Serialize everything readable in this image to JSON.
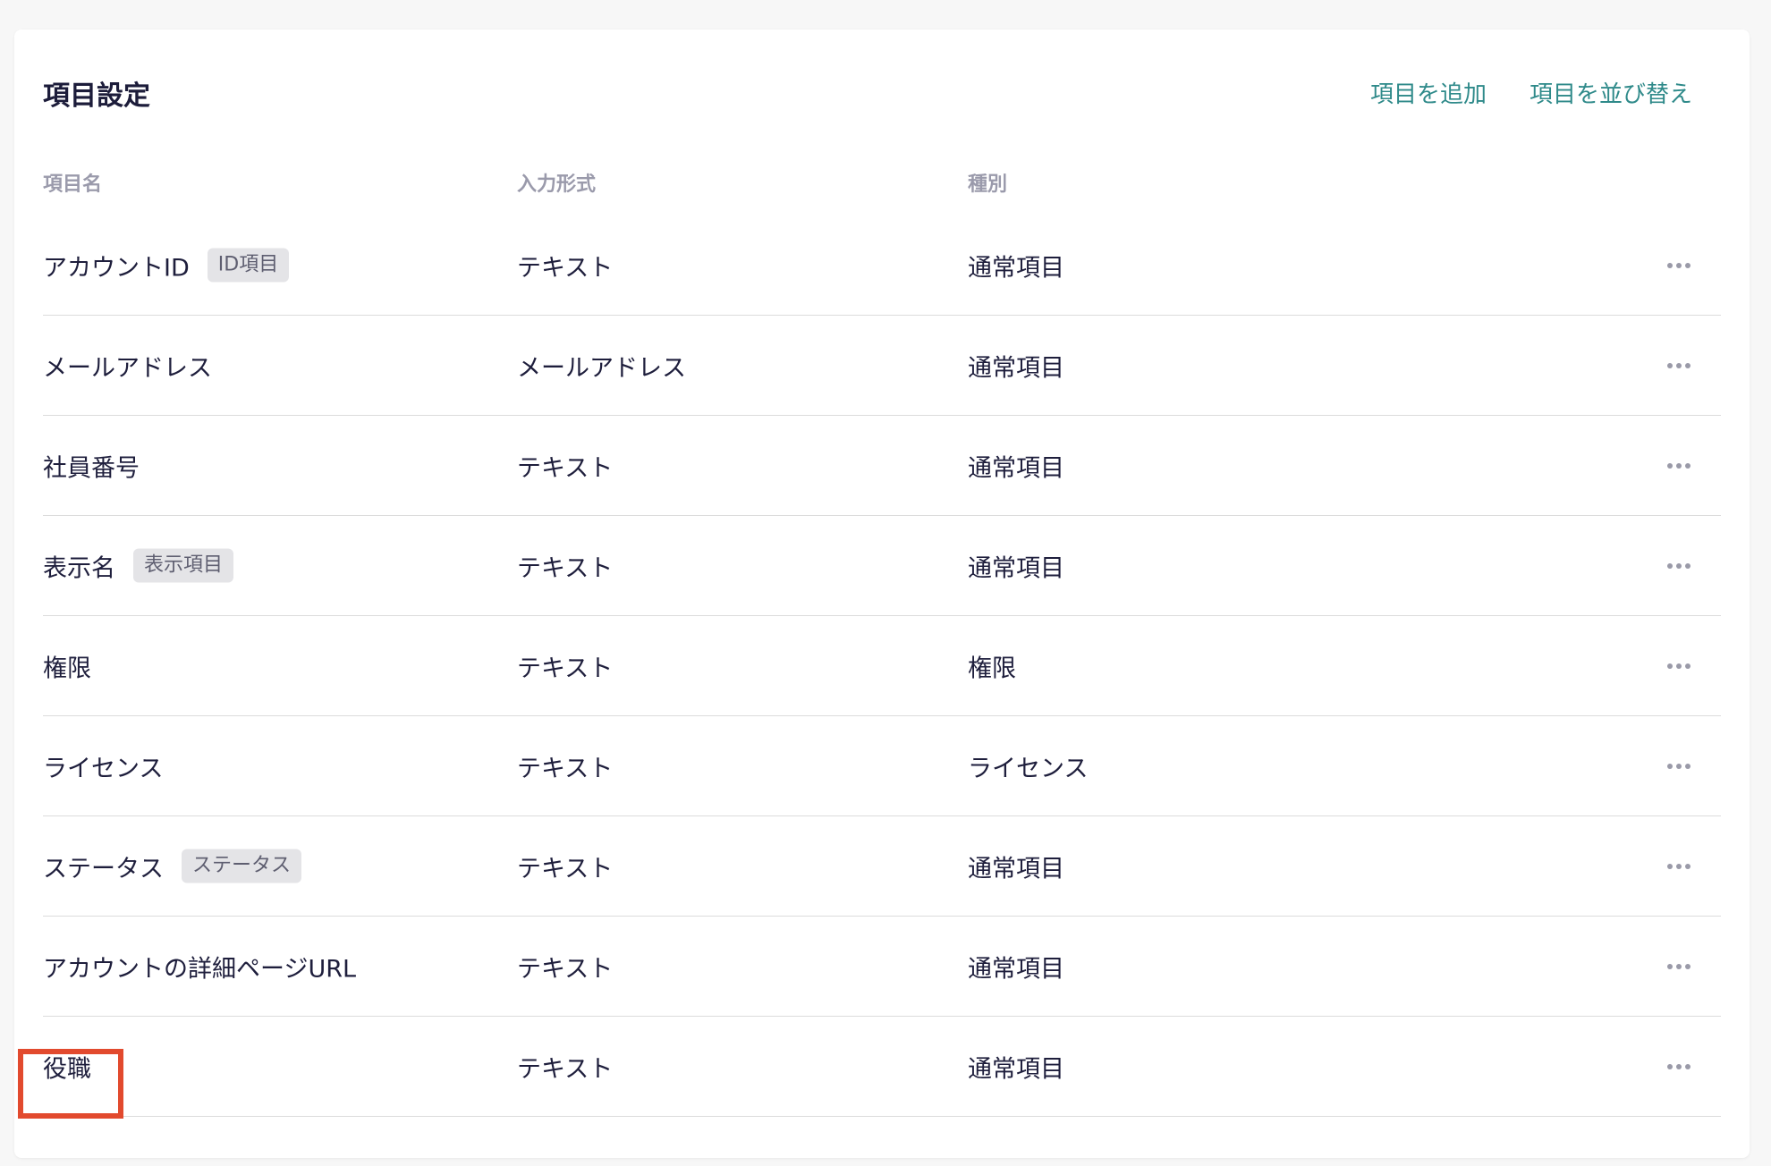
{
  "card": {
    "title": "項目設定",
    "actions": {
      "add_label": "項目を追加",
      "sort_label": "項目を並び替え"
    }
  },
  "table": {
    "headers": {
      "name": "項目名",
      "input_type": "入力形式",
      "kind": "種別"
    },
    "rows": [
      {
        "name": "アカウントID",
        "tag": "ID項目",
        "input_type": "テキスト",
        "kind": "通常項目"
      },
      {
        "name": "メールアドレス",
        "tag": "",
        "input_type": "メールアドレス",
        "kind": "通常項目"
      },
      {
        "name": "社員番号",
        "tag": "",
        "input_type": "テキスト",
        "kind": "通常項目"
      },
      {
        "name": "表示名",
        "tag": "表示項目",
        "input_type": "テキスト",
        "kind": "通常項目"
      },
      {
        "name": "権限",
        "tag": "",
        "input_type": "テキスト",
        "kind": "権限"
      },
      {
        "name": "ライセンス",
        "tag": "",
        "input_type": "テキスト",
        "kind": "ライセンス"
      },
      {
        "name": "ステータス",
        "tag": "ステータス",
        "input_type": "テキスト",
        "kind": "通常項目"
      },
      {
        "name": "アカウントの詳細ページURL",
        "tag": "",
        "input_type": "テキスト",
        "kind": "通常項目"
      },
      {
        "name": "役職",
        "tag": "",
        "input_type": "テキスト",
        "kind": "通常項目"
      }
    ]
  },
  "colors": {
    "accent": "#2f8a8a",
    "highlight": "#e24a2e",
    "text": "#1e1e3c",
    "tag_bg": "#e4e4e7"
  },
  "icons": {
    "row_menu": "more-horizontal-icon"
  },
  "highlighted_row_index": 8
}
